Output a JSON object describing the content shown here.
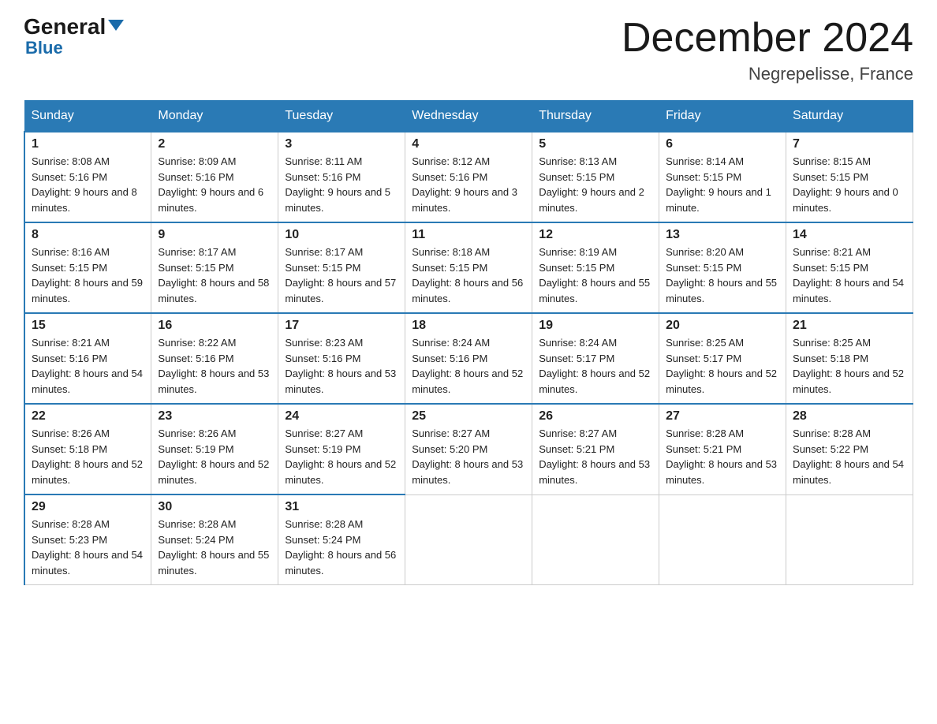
{
  "header": {
    "logo_general": "General",
    "logo_blue": "Blue",
    "month_title": "December 2024",
    "location": "Negrepelisse, France"
  },
  "days_of_week": [
    "Sunday",
    "Monday",
    "Tuesday",
    "Wednesday",
    "Thursday",
    "Friday",
    "Saturday"
  ],
  "weeks": [
    [
      {
        "day": "1",
        "sunrise": "8:08 AM",
        "sunset": "5:16 PM",
        "daylight": "9 hours and 8 minutes."
      },
      {
        "day": "2",
        "sunrise": "8:09 AM",
        "sunset": "5:16 PM",
        "daylight": "9 hours and 6 minutes."
      },
      {
        "day": "3",
        "sunrise": "8:11 AM",
        "sunset": "5:16 PM",
        "daylight": "9 hours and 5 minutes."
      },
      {
        "day": "4",
        "sunrise": "8:12 AM",
        "sunset": "5:16 PM",
        "daylight": "9 hours and 3 minutes."
      },
      {
        "day": "5",
        "sunrise": "8:13 AM",
        "sunset": "5:15 PM",
        "daylight": "9 hours and 2 minutes."
      },
      {
        "day": "6",
        "sunrise": "8:14 AM",
        "sunset": "5:15 PM",
        "daylight": "9 hours and 1 minute."
      },
      {
        "day": "7",
        "sunrise": "8:15 AM",
        "sunset": "5:15 PM",
        "daylight": "9 hours and 0 minutes."
      }
    ],
    [
      {
        "day": "8",
        "sunrise": "8:16 AM",
        "sunset": "5:15 PM",
        "daylight": "8 hours and 59 minutes."
      },
      {
        "day": "9",
        "sunrise": "8:17 AM",
        "sunset": "5:15 PM",
        "daylight": "8 hours and 58 minutes."
      },
      {
        "day": "10",
        "sunrise": "8:17 AM",
        "sunset": "5:15 PM",
        "daylight": "8 hours and 57 minutes."
      },
      {
        "day": "11",
        "sunrise": "8:18 AM",
        "sunset": "5:15 PM",
        "daylight": "8 hours and 56 minutes."
      },
      {
        "day": "12",
        "sunrise": "8:19 AM",
        "sunset": "5:15 PM",
        "daylight": "8 hours and 55 minutes."
      },
      {
        "day": "13",
        "sunrise": "8:20 AM",
        "sunset": "5:15 PM",
        "daylight": "8 hours and 55 minutes."
      },
      {
        "day": "14",
        "sunrise": "8:21 AM",
        "sunset": "5:15 PM",
        "daylight": "8 hours and 54 minutes."
      }
    ],
    [
      {
        "day": "15",
        "sunrise": "8:21 AM",
        "sunset": "5:16 PM",
        "daylight": "8 hours and 54 minutes."
      },
      {
        "day": "16",
        "sunrise": "8:22 AM",
        "sunset": "5:16 PM",
        "daylight": "8 hours and 53 minutes."
      },
      {
        "day": "17",
        "sunrise": "8:23 AM",
        "sunset": "5:16 PM",
        "daylight": "8 hours and 53 minutes."
      },
      {
        "day": "18",
        "sunrise": "8:24 AM",
        "sunset": "5:16 PM",
        "daylight": "8 hours and 52 minutes."
      },
      {
        "day": "19",
        "sunrise": "8:24 AM",
        "sunset": "5:17 PM",
        "daylight": "8 hours and 52 minutes."
      },
      {
        "day": "20",
        "sunrise": "8:25 AM",
        "sunset": "5:17 PM",
        "daylight": "8 hours and 52 minutes."
      },
      {
        "day": "21",
        "sunrise": "8:25 AM",
        "sunset": "5:18 PM",
        "daylight": "8 hours and 52 minutes."
      }
    ],
    [
      {
        "day": "22",
        "sunrise": "8:26 AM",
        "sunset": "5:18 PM",
        "daylight": "8 hours and 52 minutes."
      },
      {
        "day": "23",
        "sunrise": "8:26 AM",
        "sunset": "5:19 PM",
        "daylight": "8 hours and 52 minutes."
      },
      {
        "day": "24",
        "sunrise": "8:27 AM",
        "sunset": "5:19 PM",
        "daylight": "8 hours and 52 minutes."
      },
      {
        "day": "25",
        "sunrise": "8:27 AM",
        "sunset": "5:20 PM",
        "daylight": "8 hours and 53 minutes."
      },
      {
        "day": "26",
        "sunrise": "8:27 AM",
        "sunset": "5:21 PM",
        "daylight": "8 hours and 53 minutes."
      },
      {
        "day": "27",
        "sunrise": "8:28 AM",
        "sunset": "5:21 PM",
        "daylight": "8 hours and 53 minutes."
      },
      {
        "day": "28",
        "sunrise": "8:28 AM",
        "sunset": "5:22 PM",
        "daylight": "8 hours and 54 minutes."
      }
    ],
    [
      {
        "day": "29",
        "sunrise": "8:28 AM",
        "sunset": "5:23 PM",
        "daylight": "8 hours and 54 minutes."
      },
      {
        "day": "30",
        "sunrise": "8:28 AM",
        "sunset": "5:24 PM",
        "daylight": "8 hours and 55 minutes."
      },
      {
        "day": "31",
        "sunrise": "8:28 AM",
        "sunset": "5:24 PM",
        "daylight": "8 hours and 56 minutes."
      },
      null,
      null,
      null,
      null
    ]
  ]
}
